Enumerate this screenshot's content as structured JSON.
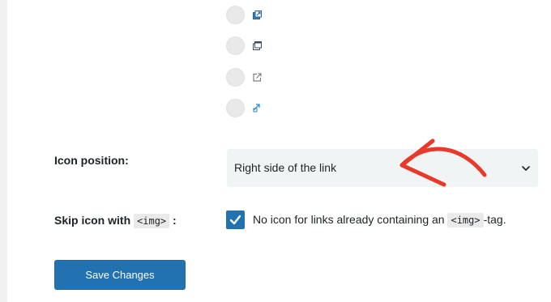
{
  "colors": {
    "accent": "#2271b1",
    "annotation_arrow": "#e8392b",
    "select_bg": "#f0f4f5"
  },
  "icon_options": [
    {
      "icon": "external-link-box-arrow-icon",
      "selected": false
    },
    {
      "icon": "new-window-icon",
      "selected": false
    },
    {
      "icon": "external-arrow-out-icon",
      "selected": false
    },
    {
      "icon": "small-link-arrow-icon",
      "selected": false
    }
  ],
  "icon_position": {
    "label": "Icon position:",
    "selected_value": "Right side of the link"
  },
  "skip_icon": {
    "label_prefix": "Skip icon with",
    "label_code": "<img>",
    "label_suffix": ":",
    "checked": true,
    "text_prefix": "No icon for links already containing an",
    "text_code": "<img>",
    "text_suffix": "-tag."
  },
  "save_button": {
    "label": "Save Changes"
  }
}
